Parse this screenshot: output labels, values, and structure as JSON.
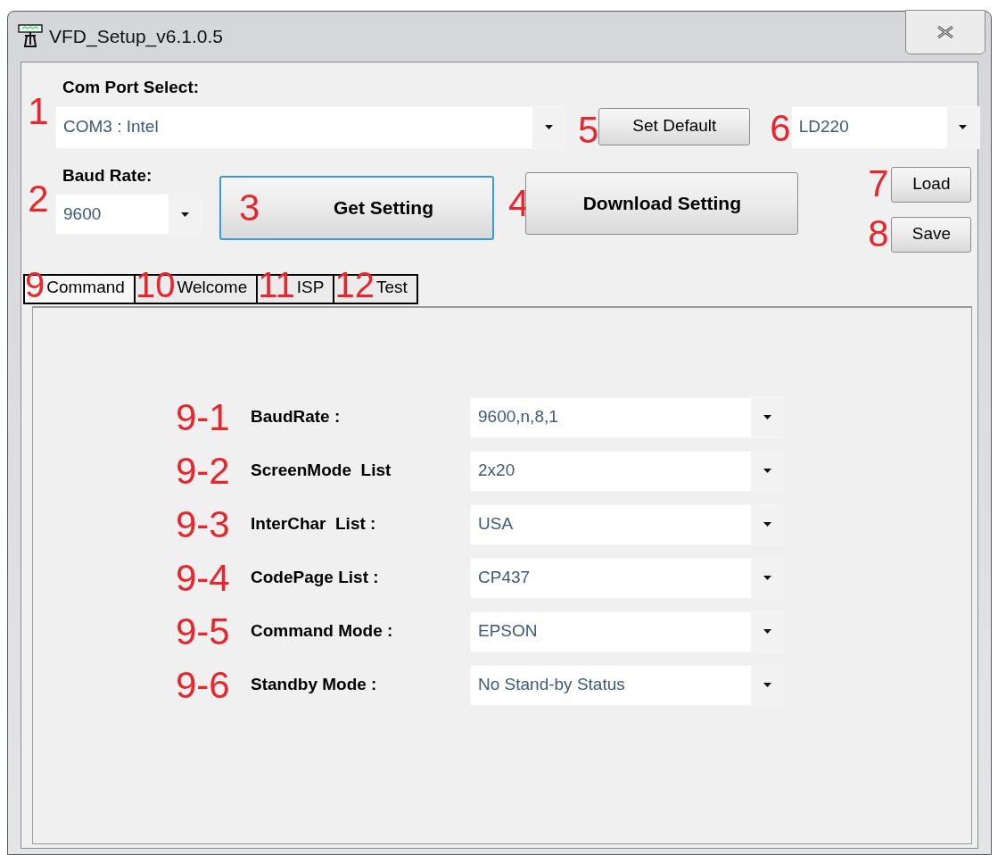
{
  "window": {
    "title": "VFD_Setup_v6.1.0.5"
  },
  "com_port": {
    "marker": "1",
    "label": "Com Port Select:",
    "value": "COM3 : Intel"
  },
  "set_default": {
    "marker": "5",
    "label": "Set Default"
  },
  "model": {
    "marker": "6",
    "value": "LD220"
  },
  "baud_rate": {
    "marker": "2",
    "label": "Baud Rate:",
    "value": "9600"
  },
  "get_setting": {
    "marker": "3",
    "label": "Get Setting",
    "focused": true
  },
  "download_setting": {
    "marker": "4",
    "label": "Download Setting",
    "focused": false
  },
  "load": {
    "marker": "7",
    "label": "Load"
  },
  "save": {
    "marker": "8",
    "label": "Save"
  },
  "tabs": [
    {
      "marker": "9",
      "label": "Command",
      "selected": true
    },
    {
      "marker": "10",
      "label": "Welcome",
      "selected": false
    },
    {
      "marker": "11",
      "label": "ISP",
      "selected": false
    },
    {
      "marker": "12",
      "label": "Test",
      "selected": false
    }
  ],
  "command_settings": [
    {
      "marker": "9-1",
      "label": "BaudRate :",
      "value": "9600,n,8,1"
    },
    {
      "marker": "9-2",
      "label": "ScreenMode  List",
      "value": "2x20"
    },
    {
      "marker": "9-3",
      "label": "InterChar  List :",
      "value": "USA"
    },
    {
      "marker": "9-4",
      "label": "CodePage List :",
      "value": "CP437"
    },
    {
      "marker": "9-5",
      "label": "Command Mode :",
      "value": "EPSON"
    },
    {
      "marker": "9-6",
      "label": "Standby Mode :",
      "value": "No Stand-by Status"
    }
  ]
}
